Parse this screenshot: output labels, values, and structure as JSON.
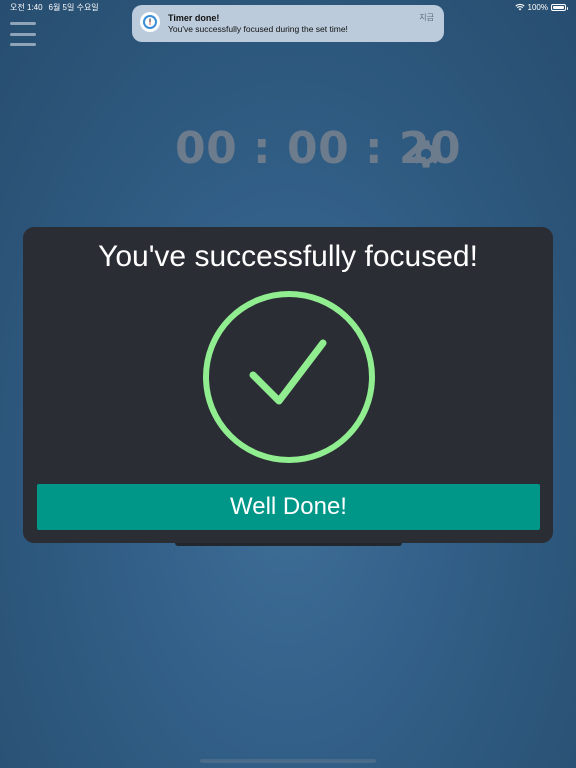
{
  "status_bar": {
    "time": "오전 1:40",
    "date": "6월 5일 수요일",
    "battery": "100%",
    "battery_level": 1.0
  },
  "notification": {
    "title": "Timer done!",
    "body": "You've successfully focused during the set time!",
    "time": "지금",
    "icon": "timer-app-icon"
  },
  "timer": {
    "display": "00 : 00 : 20"
  },
  "dialog": {
    "title": "You've successfully focused!",
    "button_label": "Well Done!",
    "check_color": "#90ee90",
    "button_color": "#009688"
  },
  "icons": {
    "menu": "hamburger-menu-icon",
    "settings": "gear-icon",
    "wifi": "wifi-icon",
    "battery": "battery-icon"
  }
}
